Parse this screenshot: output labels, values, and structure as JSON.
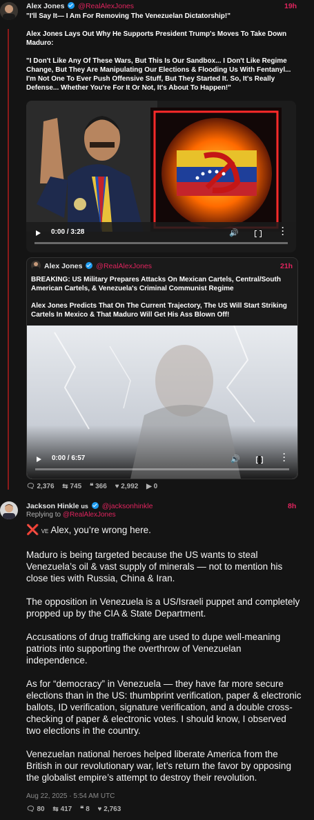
{
  "colors": {
    "accent": "#e0245e",
    "background": "#141414",
    "verified": "#1d9bf0"
  },
  "tweet1": {
    "name": "Alex Jones",
    "handle": "@RealAlexJones",
    "time": "19h",
    "paragraphs": [
      "\"I'll Say It— I Am For Removing The Venezuelan Dictatorship!\"",
      "Alex Jones Lays Out Why He Supports President Trump's Moves To Take Down Maduro:",
      "\"I Don't Like Any Of These Wars, But This Is Our Sandbox... I Don't Like Regime Change, But They Are Manipulating Our Elections & Flooding Us With Fentanyl... I'm Not One To Ever Push Offensive Stuff, But They Started It. So, It's Really Defense... Whether You're For It Or Not, It's About To Happen!\""
    ],
    "video": {
      "time": "0:00 / 3:28",
      "progress": 0
    },
    "quote": {
      "name": "Alex Jones",
      "handle": "@RealAlexJones",
      "time": "21h",
      "paragraphs": [
        "BREAKING: US Military Prepares Attacks On Mexican Cartels, Central/South American Cartels, & Venezuela's Criminal Communist Regime",
        "Alex Jones Predicts That On The Current Trajectory, The US Will Start Striking Cartels In Mexico & That Maduro Will Get His Ass Blown Off!"
      ],
      "video": {
        "time": "0:00 / 6:57",
        "progress": 0
      }
    },
    "stats": {
      "replies": "2,376",
      "retweets": "745",
      "quotes": "366",
      "likes": "2,992",
      "views": "0"
    }
  },
  "tweet2": {
    "name": "Jackson Hinkle",
    "flag": "us",
    "handle": "@jacksonhinkle",
    "time": "8h",
    "replying_label": "Replying to",
    "replying_handle": "@RealAlexJones",
    "ve_label": "VE",
    "paragraphs": [
      "Alex, you’re wrong here.",
      "Maduro is being targeted because the US wants to steal Venezuela’s oil & vast supply of minerals — not to mention his close ties with Russia, China & Iran.",
      "The opposition in Venezuela is a US/Israeli puppet and completely propped up by the CIA & State Department.",
      "Accusations of drug trafficking are used to dupe well-meaning patriots into supporting the overthrow of Venezuelan independence.",
      "As for “democracy” in Venezuela — they have far more secure elections than in the US: thumbprint verification, paper & electronic ballots, ID verification, signature verification, and a double cross-checking of paper & electronic votes. I should know, I observed two elections in the country.",
      "Venezuelan national heroes helped liberate America from the British in our revolutionary war, let’s return the favor by opposing the globalist empire’s attempt to destroy their revolution."
    ],
    "timestamp": "Aug 22, 2025 · 5:54 AM UTC",
    "stats": {
      "replies": "80",
      "retweets": "417",
      "quotes": "8",
      "likes": "2,763"
    }
  }
}
